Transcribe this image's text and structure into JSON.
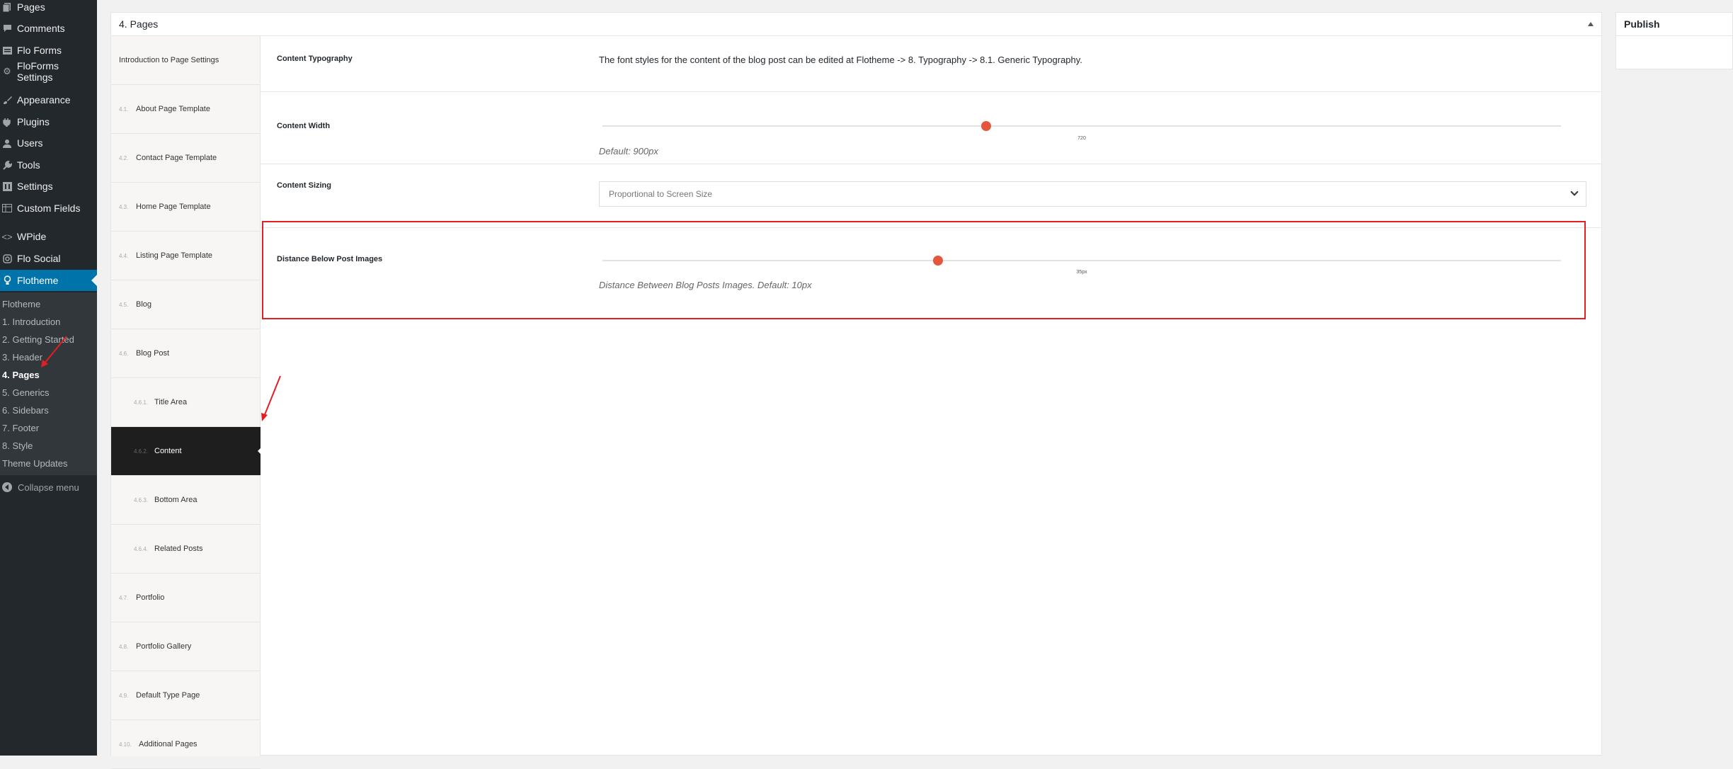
{
  "admin_menu": {
    "items": [
      {
        "label": "Pages",
        "icon": "pages-icon"
      },
      {
        "label": "Comments",
        "icon": "comments-icon"
      },
      {
        "label": "Flo Forms",
        "icon": "forms-icon"
      },
      {
        "label": "FloForms Settings",
        "icon": "gear-icon"
      },
      {
        "label": "Appearance",
        "icon": "brush-icon"
      },
      {
        "label": "Plugins",
        "icon": "plugin-icon"
      },
      {
        "label": "Users",
        "icon": "user-icon"
      },
      {
        "label": "Tools",
        "icon": "wrench-icon"
      },
      {
        "label": "Settings",
        "icon": "settings-icon"
      },
      {
        "label": "Custom Fields",
        "icon": "table-icon"
      },
      {
        "label": "WPide",
        "icon": "code-icon"
      },
      {
        "label": "Flo Social",
        "icon": "instagram-icon"
      },
      {
        "label": "Flotheme",
        "icon": "bulb-icon"
      }
    ],
    "submenu": [
      "Flotheme",
      "1. Introduction",
      "2. Getting Started",
      "3. Header",
      "4. Pages",
      "5. Generics",
      "6. Sidebars",
      "7. Footer",
      "8. Style",
      "Theme Updates"
    ],
    "collapse_label": "Collapse menu"
  },
  "panel": {
    "title": "4. Pages"
  },
  "settings_nav": [
    {
      "num": "",
      "label": "Introduction to Page Settings"
    },
    {
      "num": "4.1.",
      "label": "About Page Template"
    },
    {
      "num": "4.2.",
      "label": "Contact Page Template"
    },
    {
      "num": "4.3.",
      "label": "Home Page Template"
    },
    {
      "num": "4.4.",
      "label": "Listing Page Template"
    },
    {
      "num": "4.5.",
      "label": "Blog"
    },
    {
      "num": "4.6.",
      "label": "Blog Post"
    },
    {
      "num": "4.6.1.",
      "label": "Title Area"
    },
    {
      "num": "4.6.2.",
      "label": "Content"
    },
    {
      "num": "4.6.3.",
      "label": "Bottom Area"
    },
    {
      "num": "4.6.4.",
      "label": "Related Posts"
    },
    {
      "num": "4.7.",
      "label": "Portfolio"
    },
    {
      "num": "4.8.",
      "label": "Portfolio Gallery"
    },
    {
      "num": "4.9.",
      "label": "Default Type Page"
    },
    {
      "num": "4.10.",
      "label": "Additional Pages"
    }
  ],
  "settings": {
    "typography": {
      "label": "Content Typography",
      "description": "The font styles for the content of the blog post can be edited at Flotheme -> 8. Typography -> 8.1. Generic Typography."
    },
    "content_width": {
      "label": "Content Width",
      "value_label": "720",
      "fill_fraction": 0.4,
      "hint": "Default: 900px"
    },
    "content_sizing": {
      "label": "Content Sizing",
      "selected": "Proportional to Screen Size"
    },
    "distance_below_images": {
      "label": "Distance Below Post Images",
      "value_label": "35px",
      "fill_fraction": 0.35,
      "hint": "Distance Between Blog Posts Images. Default: 10px"
    }
  },
  "publish": {
    "title": "Publish"
  },
  "colors": {
    "accent": "#0073aa",
    "slider_handle": "#e4573d",
    "highlight": "#e31e24"
  }
}
